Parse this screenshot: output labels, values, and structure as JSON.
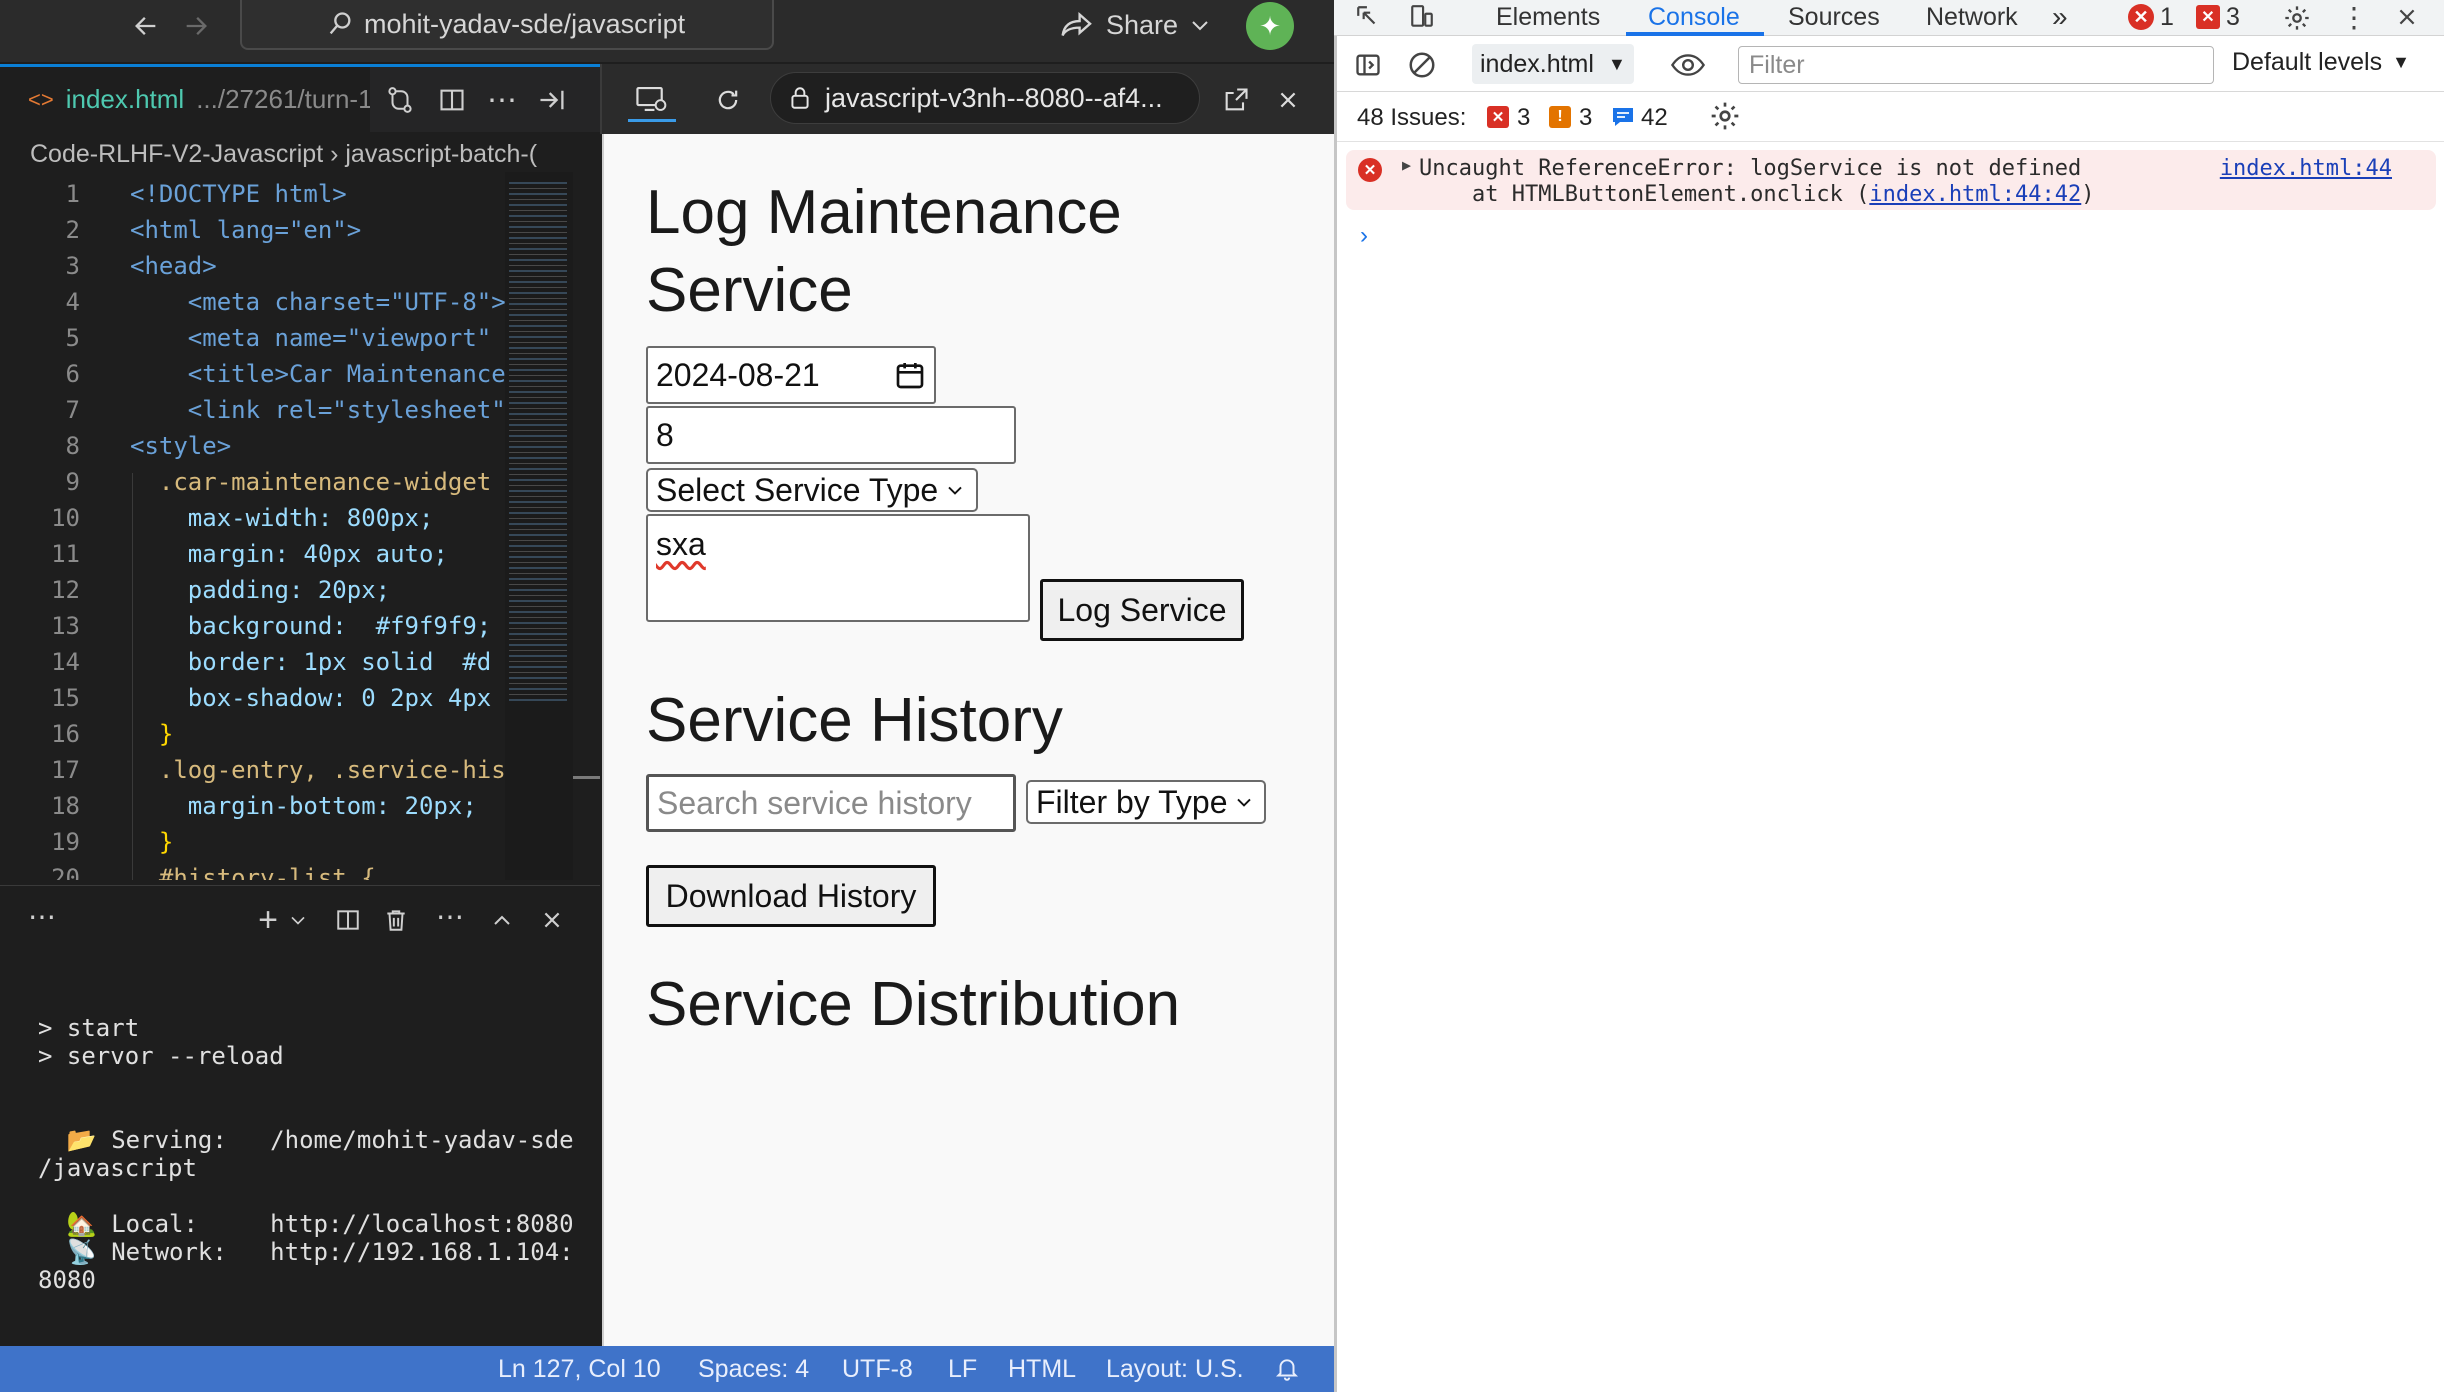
{
  "titlebar": {
    "repo": "mohit-yadav-sde/javascript",
    "share_label": "Share",
    "avatar_glyph": "✦"
  },
  "editor": {
    "tab_file": "index.html",
    "tab_path": ".../27261/turn-1",
    "breadcrumb": "Code-RLHF-V2-Javascript  ›  javascript-batch-(",
    "lines": [
      {
        "n": "1",
        "text": "<!DOCTYPE html>"
      },
      {
        "n": "2",
        "text": "<html lang=\"en\">"
      },
      {
        "n": "3",
        "text": "<head>"
      },
      {
        "n": "4",
        "text": "    <meta charset=\"UTF-8\">"
      },
      {
        "n": "5",
        "text": "    <meta name=\"viewport\""
      },
      {
        "n": "6",
        "text": "    <title>Car Maintenance"
      },
      {
        "n": "7",
        "text": "    <link rel=\"stylesheet\""
      },
      {
        "n": "8",
        "text": "<style>"
      },
      {
        "n": "9",
        "text": "  .car-maintenance-widget"
      },
      {
        "n": "10",
        "text": "    max-width: 800px;"
      },
      {
        "n": "11",
        "text": "    margin: 40px auto;"
      },
      {
        "n": "12",
        "text": "    padding: 20px;"
      },
      {
        "n": "13",
        "text": "    background:  #f9f9f9;"
      },
      {
        "n": "14",
        "text": "    border: 1px solid  #d"
      },
      {
        "n": "15",
        "text": "    box-shadow: 0 2px 4px"
      },
      {
        "n": "16",
        "text": "  }"
      },
      {
        "n": "17",
        "text": "  .log-entry, .service-his"
      },
      {
        "n": "18",
        "text": "    margin-bottom: 20px;"
      },
      {
        "n": "19",
        "text": "  }"
      },
      {
        "n": "20",
        "text": "  #history-list {"
      }
    ]
  },
  "terminal": {
    "lines": [
      "> start",
      "> servor --reload",
      "",
      "",
      "  📂 Serving:   /home/mohit-yadav-sde",
      "/javascript",
      "",
      "  🏡 Local:     http://localhost:8080",
      "  📡 Network:   http://192.168.1.104:",
      "8080"
    ]
  },
  "statusbar": {
    "position": "Ln 127, Col 10",
    "spaces": "Spaces: 4",
    "encoding": "UTF-8",
    "eol": "LF",
    "language": "HTML",
    "layout": "Layout: U.S."
  },
  "preview": {
    "url": "javascript-v3nh--8080--af4...",
    "heading_log_1": "Log Maintenance",
    "heading_log_2": "Service",
    "date_value": "2024-08-21",
    "mileage_value": "8",
    "service_type_selected": "Select Service Type",
    "notes_value": "sxa",
    "log_button": "Log Service",
    "heading_history": "Service History",
    "search_placeholder": "Search service history",
    "filter_selected": "Filter by Type",
    "download_button": "Download History",
    "heading_distribution": "Service Distribution"
  },
  "devtools": {
    "tabs": [
      "Elements",
      "Console",
      "Sources",
      "Network"
    ],
    "active_tab": "Console",
    "error_count": "1",
    "warning_count": "3",
    "context": "index.html",
    "filter_placeholder": "Filter",
    "levels": "Default levels",
    "issues_label": "48 Issues:",
    "issues_errors": "3",
    "issues_warnings": "3",
    "issues_info": "42",
    "error_line1": "Uncaught ReferenceError: logService is not defined",
    "error_line2_prefix": "    at HTMLButtonElement.onclick (",
    "error_line2_link": "index.html:44:42",
    "error_line2_suffix": ")",
    "error_source": "index.html:44"
  },
  "colors": {
    "accent_blue": "#0a7fd6",
    "status_bar": "#3f73c9",
    "error_red": "#d93025"
  }
}
